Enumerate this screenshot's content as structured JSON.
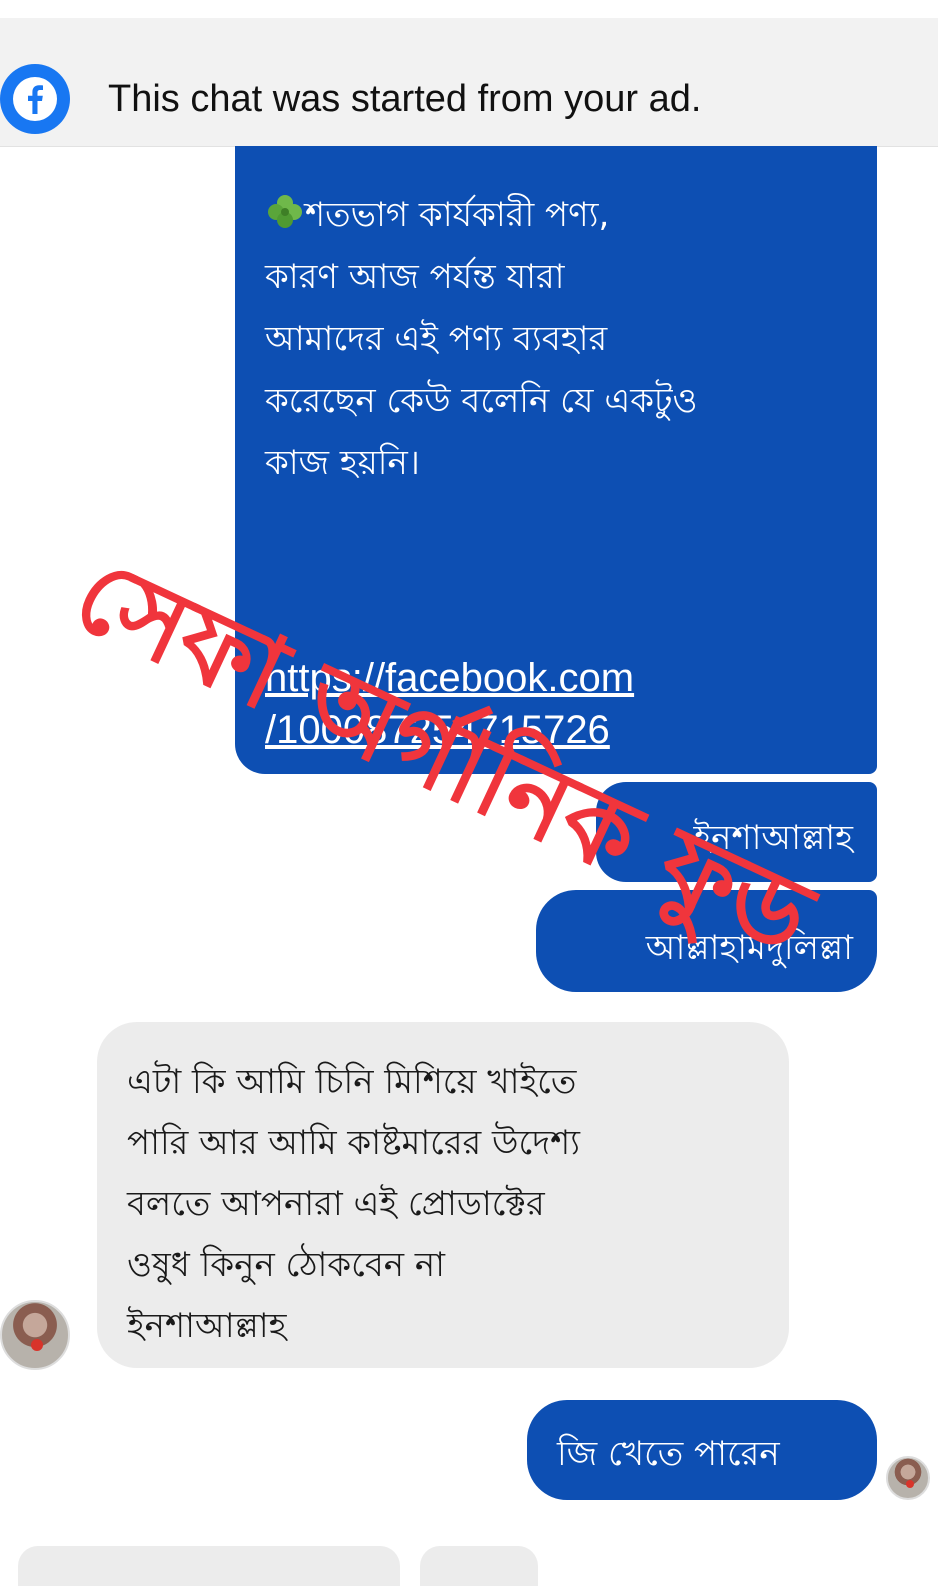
{
  "banner": {
    "text": "This chat was started from your ad.",
    "icon": "facebook-icon",
    "icon_color": "#1877f2"
  },
  "messages": [
    {
      "side": "outgoing",
      "icon": "shamrock-icon",
      "lines": [
        "শতভাগ  কার্যকারী পণ্য,",
        "কারণ আজ পর্যন্ত যারা",
        "আমাদের এই পণ্য ব্যবহার",
        "করেছেন কেউ বলেনি যে একটুও",
        "কাজ হয়নি।"
      ],
      "link_lines": [
        "https://facebook.com",
        "/100087254715726"
      ]
    },
    {
      "side": "outgoing",
      "text": "ইনশাআল্লাহ"
    },
    {
      "side": "outgoing",
      "text": "আল্লাহামদুলিল্লা"
    },
    {
      "side": "incoming",
      "lines": [
        "এটা কি আমি চিনি মিশিয়ে খাইতে",
        "পারি আর আমি কাষ্টমারের উদেশ্য",
        "বলতে আপনারা এই প্রোডাক্টের",
        "ওষুধ কিনুন ঠোকবেন না",
        "ইনশাআল্লাহ"
      ]
    },
    {
      "side": "outgoing",
      "text": "জি খেতে পারেন"
    }
  ],
  "watermark": {
    "text": "সেফা অর্গানিক ফুড",
    "color": "#f0353c"
  },
  "colors": {
    "outgoing_bubble": "#0d4fb3",
    "incoming_bubble": "#ececec"
  }
}
